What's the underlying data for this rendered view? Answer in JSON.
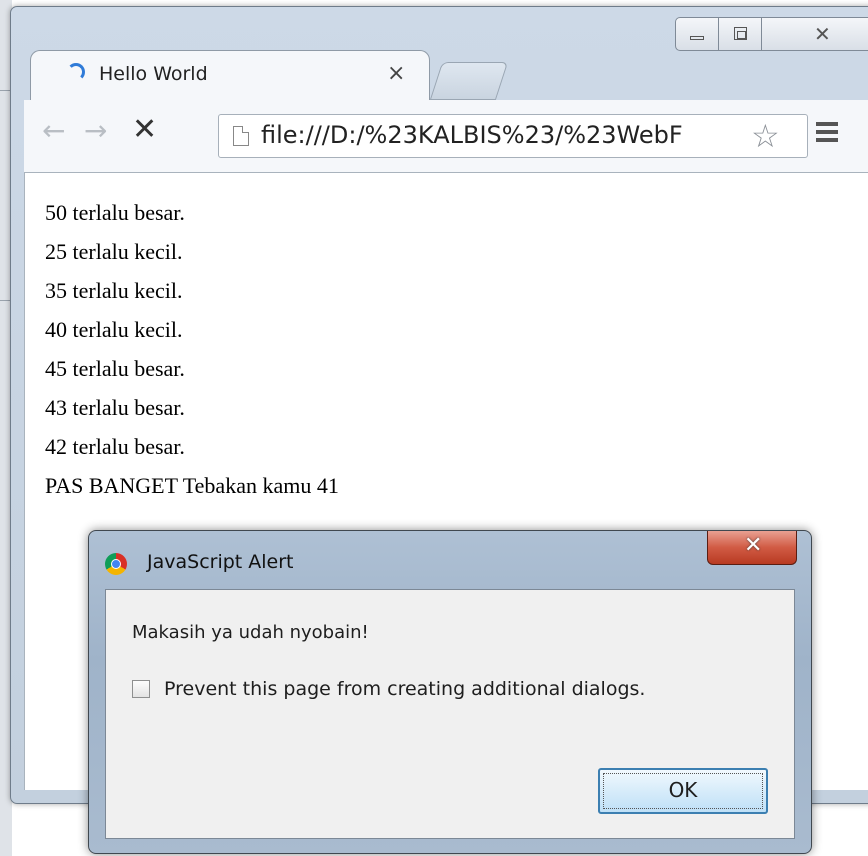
{
  "browser": {
    "tab_title": "Hello World",
    "tab_close": "×",
    "url": "file:///D:/%23KALBIS%23/%23WebF",
    "nav": {
      "back": "←",
      "forward": "→",
      "stop": "✕",
      "star": "☆"
    }
  },
  "window_controls": {
    "close": "✕"
  },
  "page": {
    "lines": [
      "50 terlalu besar.",
      "25 terlalu kecil.",
      "35 terlalu kecil.",
      "40 terlalu kecil.",
      "45 terlalu besar.",
      "43 terlalu besar.",
      "42 terlalu besar."
    ],
    "final": "PAS BANGET Tebakan kamu 41"
  },
  "dialog": {
    "title": "JavaScript Alert",
    "close": "✕",
    "message": "Makasih ya udah nyobain!",
    "checkbox_label": "Prevent this page from creating additional dialogs.",
    "ok_label": "OK"
  }
}
